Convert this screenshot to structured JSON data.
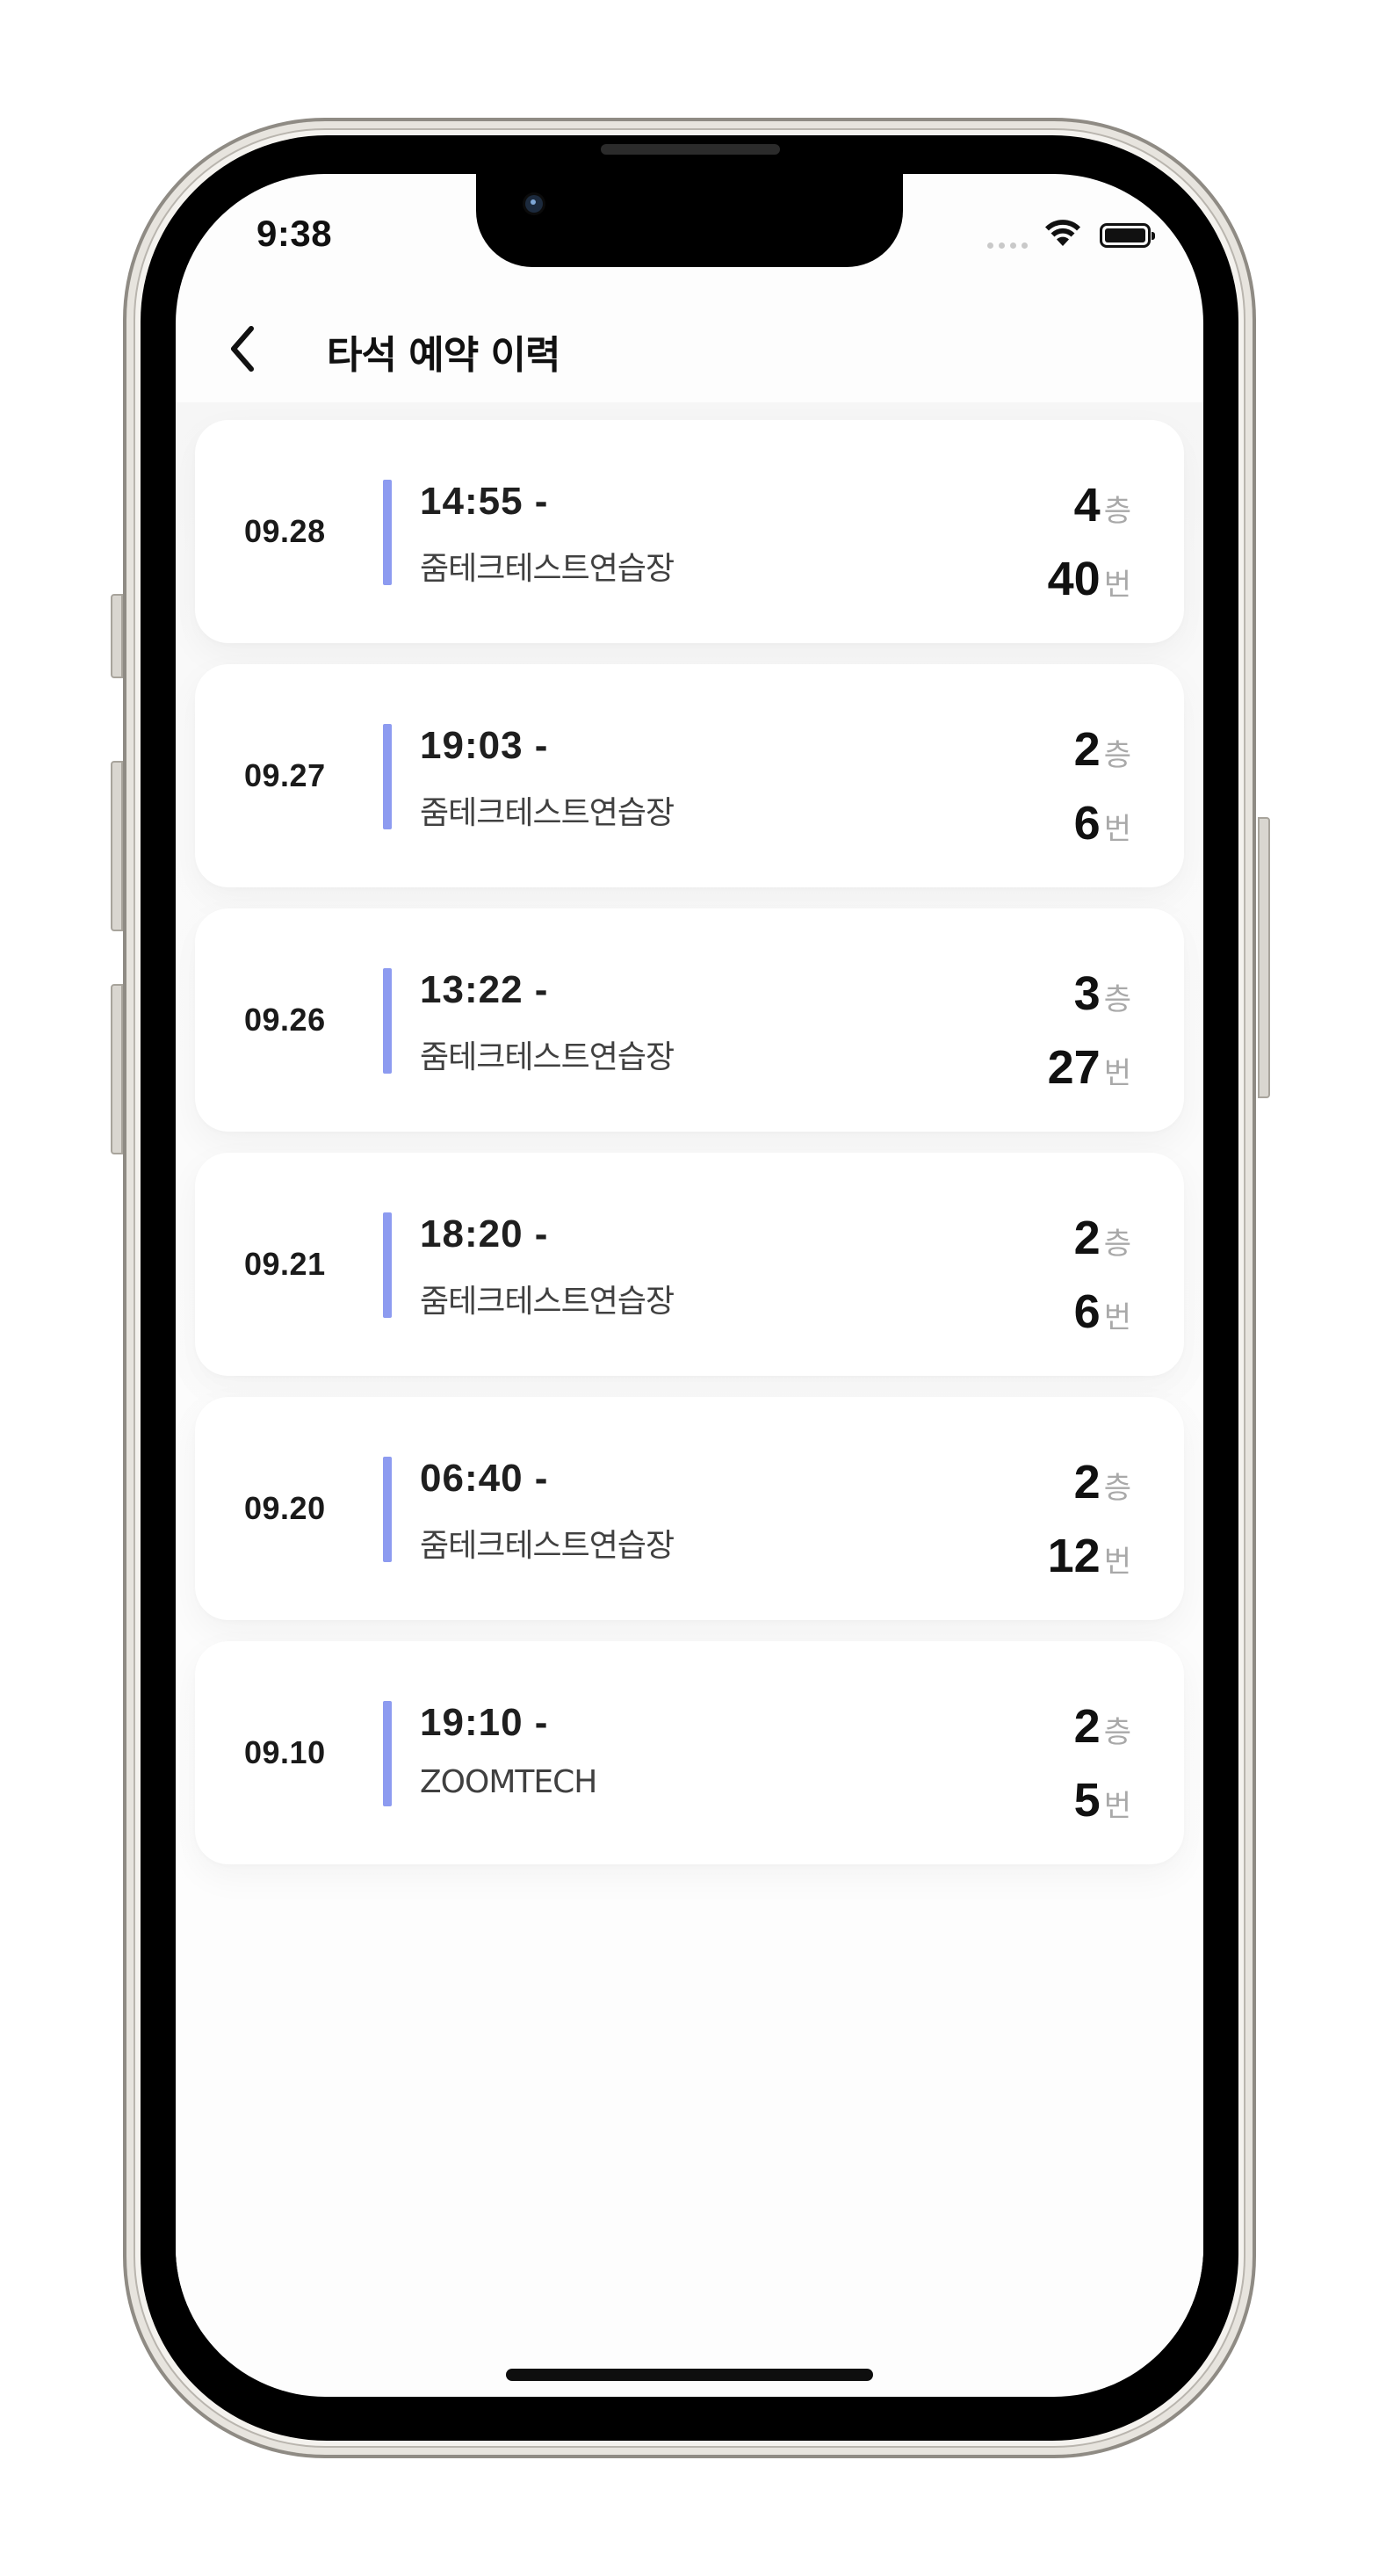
{
  "status_bar": {
    "time": "9:38"
  },
  "header": {
    "title": "타석 예약 이력"
  },
  "reservations": [
    {
      "date": "09.28",
      "time": "14:55 -",
      "place": "줌테크테스트연습장",
      "floor": "4",
      "floor_unit": "층",
      "seat": "40",
      "seat_unit": "번"
    },
    {
      "date": "09.27",
      "time": "19:03 -",
      "place": "줌테크테스트연습장",
      "floor": "2",
      "floor_unit": "층",
      "seat": "6",
      "seat_unit": "번"
    },
    {
      "date": "09.26",
      "time": "13:22 -",
      "place": "줌테크테스트연습장",
      "floor": "3",
      "floor_unit": "층",
      "seat": "27",
      "seat_unit": "번"
    },
    {
      "date": "09.21",
      "time": "18:20 -",
      "place": "줌테크테스트연습장",
      "floor": "2",
      "floor_unit": "층",
      "seat": "6",
      "seat_unit": "번"
    },
    {
      "date": "09.20",
      "time": "06:40 -",
      "place": "줌테크테스트연습장",
      "floor": "2",
      "floor_unit": "층",
      "seat": "12",
      "seat_unit": "번"
    },
    {
      "date": "09.10",
      "time": "19:10 -",
      "place": "ZOOMTECH",
      "floor": "2",
      "floor_unit": "층",
      "seat": "5",
      "seat_unit": "번"
    }
  ],
  "colors": {
    "accent_bar": "#8d9bf0",
    "unit_text": "#a9a9a9"
  }
}
